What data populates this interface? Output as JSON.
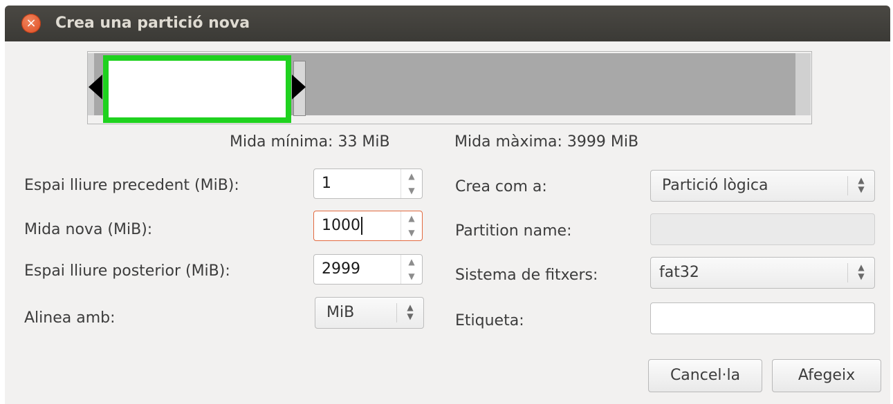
{
  "window": {
    "title": "Crea una partició nova",
    "close_icon": "×"
  },
  "sizes": {
    "min": "Mida mínima: 33 MiB",
    "max": "Mida màxima: 3999 MiB"
  },
  "left_form": {
    "free_before": {
      "label": "Espai lliure precedent (MiB):",
      "value": "1"
    },
    "new_size": {
      "label": "Mida nova (MiB):",
      "value": "1000"
    },
    "free_after": {
      "label": "Espai lliure posterior (MiB):",
      "value": "2999"
    },
    "align": {
      "label": "Alinea amb:",
      "value": "MiB"
    }
  },
  "right_form": {
    "create_as": {
      "label": "Crea com a:",
      "value": "Partició lògica"
    },
    "partition_name": {
      "label": "Partition name:",
      "value": ""
    },
    "filesystem": {
      "label": "Sistema de fitxers:",
      "value": "fat32"
    },
    "tag": {
      "label": "Etiqueta:",
      "value": ""
    }
  },
  "buttons": {
    "cancel": "Cancel·la",
    "add": "Afegeix"
  },
  "colors": {
    "new_partition": "#1fd21f",
    "unallocated": "#a8a8a8",
    "focus": "#e2693f",
    "close": "#de4a20"
  },
  "icons": {
    "spin_up": "▲",
    "spin_down": "▼"
  },
  "partition_bar": {
    "new_size_mib": 1000,
    "free_before_mib": 1,
    "free_after_mib": 2999
  }
}
